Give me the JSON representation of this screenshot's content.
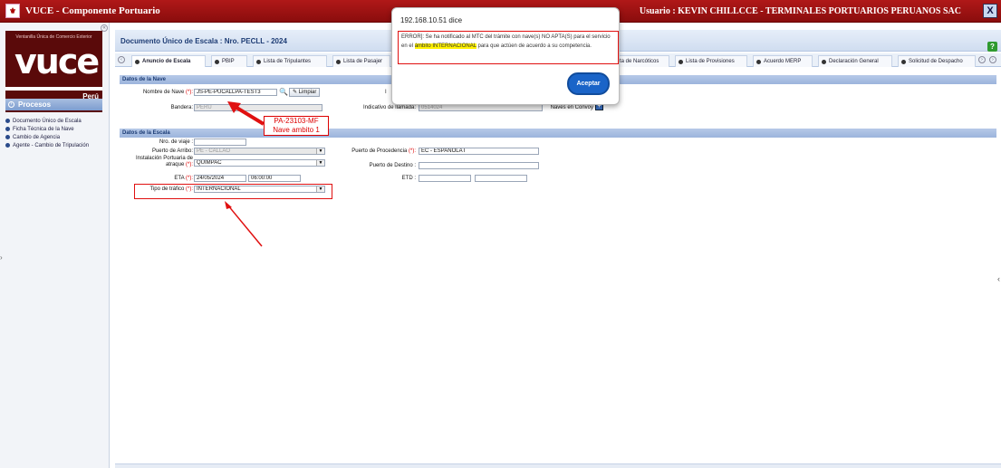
{
  "app": {
    "title": "VUCE - Componente Portuario",
    "user_label": "Usuario : KEVIN CHILLCCE - TERMINALES PORTUARIOS PERUANOS SAC",
    "close_label": "X"
  },
  "sidebar": {
    "tagline": "Ventanilla Única de Comercio Exterior",
    "logo_text": "vuce",
    "country": "Perú",
    "section_title": "Procesos",
    "items": [
      {
        "label": "Documento Único de Escala"
      },
      {
        "label": "Ficha Técnica de la Nave"
      },
      {
        "label": "Cambio de Agencia"
      },
      {
        "label": "Agente - Cambio de Tripulación"
      }
    ]
  },
  "document": {
    "title": "Documento Único de Escala : Nro.  PECLL - 2024",
    "help": "?"
  },
  "tabs": [
    {
      "label": "Anuncio de Escala",
      "active": true
    },
    {
      "label": "PBIP"
    },
    {
      "label": "Lista de Tripulantes"
    },
    {
      "label": "Lista de Pasajer"
    },
    {
      "label": "ta de Narcóticos"
    },
    {
      "label": "Lista de Provisiones"
    },
    {
      "label": "Acuerdo MERP"
    },
    {
      "label": "Declaración General"
    },
    {
      "label": "Solicitud de Despacho"
    }
  ],
  "nave": {
    "section": "Datos de la Nave",
    "nombre_label": "Nombre de Nave",
    "required_mark": "(*):",
    "nombre_value": "JS-PE-PUCALLPA-TEST3",
    "limpiar": "Limpiar",
    "bandera_label": "Bandera:",
    "bandera_value": "PERU",
    "indicativo_label": "Indicativo de llamada:",
    "indicativo_value": "0514024",
    "convoy_label": "Naves en Convoy",
    "convoy_btn": "+"
  },
  "escala": {
    "section": "Datos de la Escala",
    "viaje_label": "Nro. de viaje :",
    "viaje_value": "",
    "arribo_label": "Puerto de Arribo:",
    "arribo_value": "PE - CALLAO",
    "procedencia_label": "Puerto de Procedencia",
    "procedencia_value": "EC - ESPANOLA I",
    "instalacion_label_1": "Instalación Portuaria de",
    "instalacion_label_2": "atraque",
    "instalacion_value": "QUIMPAC",
    "destino_label": "Puerto de Destino :",
    "destino_value": "",
    "eta_label": "ETA",
    "eta_date": "24/05/2024",
    "eta_time": "06:00:00",
    "etd_label": "ETD :",
    "trafico_label": "Tipo de tráfico",
    "trafico_value": "INTERNACIONAL"
  },
  "annotation": {
    "line1": "PA-23103-MF",
    "line2": "Nave ambito 1"
  },
  "dialog": {
    "title": "192.168.10.51 dice",
    "msg_before": "ERROR]: Se ha notificado al MTC del trámite con nave(s) NO APTA(S) para el servicio en el ",
    "msg_highlight": "ámbito INTERNACIONAL",
    "msg_after": " para que actúen de acuerdo a su competencia.",
    "accept": "Aceptar"
  },
  "colors": {
    "brand_red": "#a01414",
    "section_blue": "#9cb4dc",
    "annotation_red": "#e01010",
    "accept_blue": "#1a64c8"
  }
}
